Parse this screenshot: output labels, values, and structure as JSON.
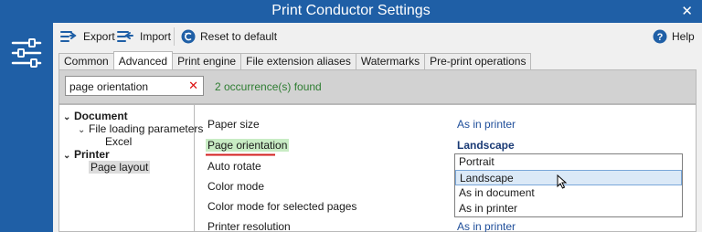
{
  "window": {
    "title": "Print Conductor Settings",
    "close_glyph": "✕"
  },
  "toolbar": {
    "export_label": "Export",
    "import_label": "Import",
    "reset_label": "Reset to default",
    "help_label": "Help"
  },
  "tabs": [
    {
      "label": "Common",
      "active": false
    },
    {
      "label": "Advanced",
      "active": true
    },
    {
      "label": "Print engine",
      "active": false
    },
    {
      "label": "File extension aliases",
      "active": false
    },
    {
      "label": "Watermarks",
      "active": false
    },
    {
      "label": "Pre-print operations",
      "active": false
    }
  ],
  "search": {
    "value": "page orientation",
    "clear_glyph": "✕",
    "result": "2 occurrence(s) found"
  },
  "tree": {
    "document": "Document",
    "file_loading": "File loading parameters",
    "excel": "Excel",
    "printer": "Printer",
    "page_layout": "Page layout"
  },
  "properties": [
    {
      "name": "Paper size",
      "value": "As in printer"
    },
    {
      "name": "Page orientation",
      "value": "Landscape"
    },
    {
      "name": "Auto rotate",
      "value": ""
    },
    {
      "name": "Color mode",
      "value": ""
    },
    {
      "name": "Color mode for selected pages",
      "value": ""
    },
    {
      "name": "Printer resolution",
      "value": "As in printer"
    }
  ],
  "dropdown": {
    "options": [
      "Portrait",
      "Landscape",
      "As in document",
      "As in printer"
    ],
    "hovered": "Landscape"
  },
  "colors": {
    "accent": "#1f5fa6",
    "highlight": "#c8ecc4",
    "found_text": "#2e7d32",
    "value_text": "#1f4e9a"
  }
}
